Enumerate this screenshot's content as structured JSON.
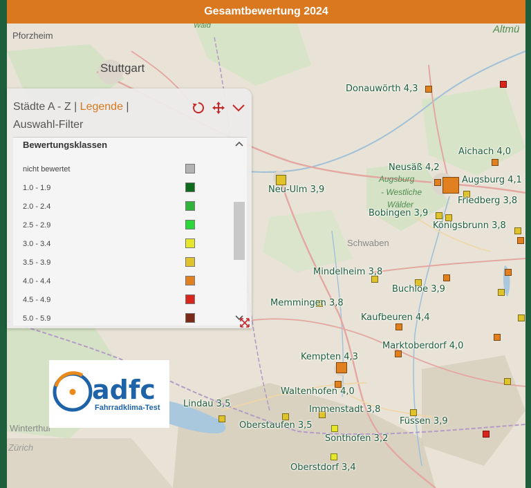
{
  "header": {
    "title": "Gesamtbewertung 2024"
  },
  "panel": {
    "tabs": {
      "cities": "Städte A - Z",
      "separator": "|",
      "legend": "Legende",
      "filter": "Auswahl-Filter"
    },
    "tool_icons": [
      "reset-icon",
      "move-icon",
      "chevron-down-icon"
    ],
    "legend": {
      "title": "Bewertungsklassen",
      "items": [
        {
          "label": "nicht bewertet",
          "color": "#b3b3b3"
        },
        {
          "label": "1.0 - 1.9",
          "color": "#0d6b1c"
        },
        {
          "label": "2.0 - 2.4",
          "color": "#2fb33a"
        },
        {
          "label": "2.5 - 2.9",
          "color": "#2ad83a"
        },
        {
          "label": "3.0 - 3.4",
          "color": "#e6e62a"
        },
        {
          "label": "3.5 - 3.9",
          "color": "#e0c22a"
        },
        {
          "label": "4.0 - 4.4",
          "color": "#e0801e"
        },
        {
          "label": "4.5 - 4.9",
          "color": "#d9261c"
        },
        {
          "label": "5.0 - 5.9",
          "color": "#7a2a16"
        }
      ],
      "scroll_position": 0.42
    }
  },
  "map": {
    "places": {
      "pforzheim": "Pforzheim",
      "stuttgart": "Stuttgart",
      "wald": "Wald",
      "altmuehl": "Altmü",
      "schwaben": "Schwaben",
      "naturpark": [
        "Augsburg",
        "- Westliche",
        "Wälder"
      ],
      "winterthur": "Winterthur",
      "zuerich": "Zürich"
    },
    "cities": [
      {
        "name": "Donauwörth 4,3",
        "class": "4.0 - 4.4"
      },
      {
        "name": "Aichach 4,0",
        "class": "4.0 - 4.4"
      },
      {
        "name": "Neusäß 4,2",
        "class": "4.0 - 4.4"
      },
      {
        "name": "Augsburg 4,1",
        "class": "4.0 - 4.4"
      },
      {
        "name": "Friedberg 3,8",
        "class": "3.5 - 3.9"
      },
      {
        "name": "Neu-Ulm 3,9",
        "class": "3.5 - 3.9"
      },
      {
        "name": "Bobingen 3,9",
        "class": "3.5 - 3.9"
      },
      {
        "name": "Königsbrunn 3,8",
        "class": "3.5 - 3.9"
      },
      {
        "name": "Mindelheim 3,8",
        "class": "3.5 - 3.9"
      },
      {
        "name": "Buchloe 3,9",
        "class": "3.5 - 3.9"
      },
      {
        "name": "Memmingen 3,8",
        "class": "3.5 - 3.9"
      },
      {
        "name": "Kaufbeuren 4,4",
        "class": "4.0 - 4.4"
      },
      {
        "name": "Marktoberdorf 4,0",
        "class": "4.0 - 4.4"
      },
      {
        "name": "Kempten 4,3",
        "class": "4.0 - 4.4"
      },
      {
        "name": "Waltenhofen 4,0",
        "class": "4.0 - 4.4"
      },
      {
        "name": "Immenstadt 3,8",
        "class": "3.5 - 3.9"
      },
      {
        "name": "Lindau 3,5",
        "class": "3.5 - 3.9"
      },
      {
        "name": "Oberstaufen 3,5",
        "class": "3.5 - 3.9"
      },
      {
        "name": "Füssen 3,9",
        "class": "3.5 - 3.9"
      },
      {
        "name": "Sonthofen 3,2",
        "class": "3.0 - 3.4"
      },
      {
        "name": "Oberstdorf 3,4",
        "class": "3.0 - 3.4"
      }
    ],
    "unlabeled_markers": [
      "4.5 - 4.9",
      "4.0 - 4.4",
      "3.5 - 3.9",
      "4.0 - 4.4",
      "4.0 - 4.4",
      "3.5 - 3.9",
      "3.5 - 3.9",
      "4.0 - 4.4",
      "3.5 - 3.9",
      "4.5 - 4.9"
    ]
  },
  "logo": {
    "brand": "adfc",
    "subtitle": "Fahrradklima-Test"
  },
  "colors": {
    "header": "#d9781e",
    "border_green": "#1f5e3c",
    "label_green": "#1e5c3c"
  }
}
